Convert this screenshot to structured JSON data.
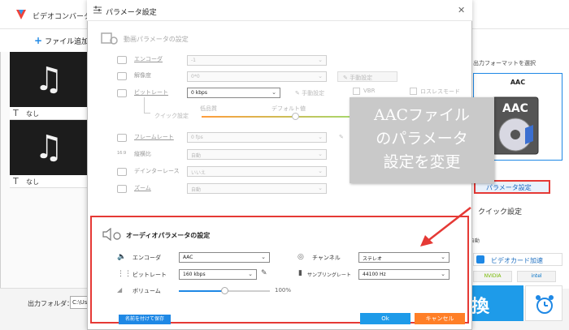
{
  "app": {
    "title": "ビデオコンバータ",
    "add_file": "ファイル追加",
    "file_items": [
      {
        "subtitle_icon": "T",
        "subtitle": "なし"
      },
      {
        "subtitle_icon": "T",
        "subtitle": "なし"
      }
    ],
    "output_folder_label": "出力フォルダ：",
    "output_folder_value": "C:\\Use"
  },
  "right_panel": {
    "select_format_label": "出力フォーマットを選択",
    "format_name": "AAC",
    "format_icon_text": "AAC",
    "param_button": "パラメータ設定",
    "quick_settings": "クイック設定",
    "auto_label": "自動",
    "gpu_accel": "ビデオカード加速",
    "nvidia": "NVIDIA",
    "intel": "intel",
    "convert_label": "換"
  },
  "dialog": {
    "title": "パラメータ設定",
    "video_section_title": "動画パラメータの設定",
    "video_rows": {
      "encoder": {
        "label": "エンコーダ",
        "value": "-1"
      },
      "resolution": {
        "label": "解像度",
        "value": "0*0"
      },
      "bitrate": {
        "label": "ビットレート",
        "value": "0 kbps"
      },
      "manual_1": "手動設定",
      "manual_2": "手動設定",
      "manual_3": "手動設定",
      "vbr": "VBR",
      "lossless": "ロスレスモード",
      "quick_setting": "クイック設定",
      "low_quality": "低品質",
      "default_value": "デフォルト値",
      "framerate": {
        "label": "フレームレート",
        "value": "0 fps"
      },
      "aspect": {
        "label": "縦横比",
        "value": "自動"
      },
      "deinterlace": {
        "label": "デインターレース",
        "value": "いいえ"
      },
      "zoom": {
        "label": "ズーム",
        "value": "自動"
      }
    },
    "audio_section_title": "オーディオパラメータの設定",
    "audio": {
      "encoder": {
        "label": "エンコーダ",
        "value": "AAC"
      },
      "channel": {
        "label": "チャンネル",
        "value": "ステレオ"
      },
      "bitrate": {
        "label": "ビットレート",
        "value": "160 kbps"
      },
      "samplerate": {
        "label": "サンプリングレート",
        "value": "44100 Hz"
      },
      "volume": {
        "label": "ボリューム",
        "value": "100%",
        "level": 0.5
      }
    },
    "save_name_button": "名前を付けて保存",
    "ok_button": "Ok",
    "cancel_button": "キャンセル"
  },
  "callout": {
    "lines": [
      "AACファイル",
      "のパラメータ",
      "設定を変更"
    ]
  },
  "colors": {
    "accent": "#1e88e5",
    "highlight": "#e53935",
    "cancel": "#ff7f27",
    "callout_bg": "#c9c9c9"
  }
}
